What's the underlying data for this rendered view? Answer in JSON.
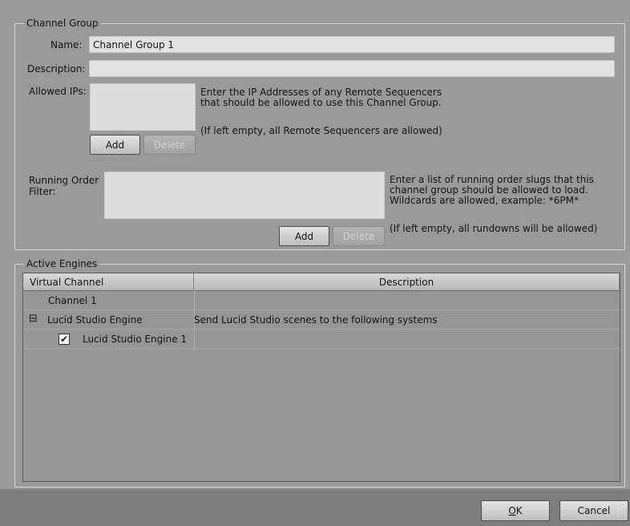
{
  "channel_group": {
    "legend": "Channel Group",
    "name_label": "Name:",
    "name_value": "Channel Group 1",
    "description_label": "Description:",
    "description_value": "",
    "allowed_ips_label": "Allowed IPs:",
    "allowed_ips_help_line1": "Enter the IP Addresses of any Remote Sequencers",
    "allowed_ips_help_line2": "that should be allowed to use this Channel Group.",
    "allowed_ips_help_note": "(If left empty, all Remote Sequencers are allowed)",
    "add_label": "Add",
    "delete_label": "Delete",
    "running_order_label_line1": "Running Order",
    "running_order_label_line2": "Filter:",
    "running_order_help_line1": "Enter a list of running order slugs that this",
    "running_order_help_line2": "channel group should be allowed to load.",
    "running_order_help_line3": "Wildcards are allowed, example: *6PM*",
    "running_order_help_note": "(If left empty, all rundowns will be allowed)"
  },
  "active_engines": {
    "legend": "Active Engines",
    "columns": [
      "Virtual Channel",
      "Description"
    ],
    "rows": [
      {
        "name": "Channel 1",
        "description": ""
      },
      {
        "name": "Lucid Studio Engine",
        "description": "Send Lucid Studio scenes to the following systems",
        "expander": "⊟"
      },
      {
        "name": "Lucid Studio Engine 1",
        "description": "",
        "checked": true,
        "check_glyph": "✔"
      }
    ]
  },
  "footer": {
    "ok_prefix": "",
    "ok_mnemonic": "O",
    "ok_rest": "K",
    "cancel_label": "Cancel"
  },
  "colors": {
    "panel": "#9a9a9a",
    "frame": "#7e7e7e",
    "field": "#e2e2e2"
  }
}
